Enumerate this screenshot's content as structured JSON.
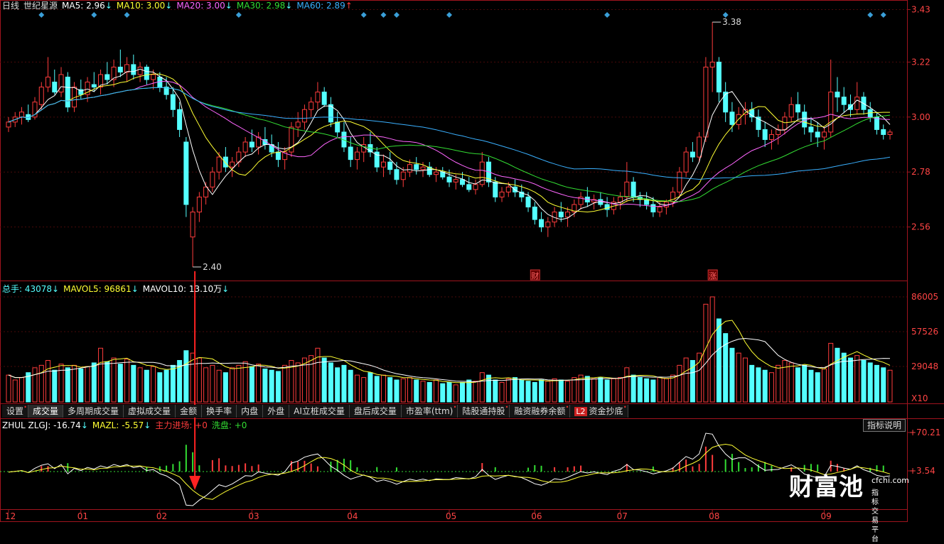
{
  "header": {
    "period": "日线",
    "stock_name": "世纪星源",
    "ma5": "MA5: 2.96",
    "ma10": "MA10: 3.00",
    "ma20": "MA20: 3.00",
    "ma30": "MA30: 2.98",
    "ma60": "MA60: 2.89",
    "arrow_down": "↓",
    "arrow_up": "↑"
  },
  "volume_header": {
    "total": "总手: 43078",
    "mavol5": "MAVOL5: 96861",
    "mavol10": "MAVOL10: 13.10万"
  },
  "indicator_header": {
    "name": "ZHUL ZLGJ: -16.74",
    "mazl": "MAZL: -5.57",
    "main_entry": "主力进场: +0",
    "wash": "洗盘: +0"
  },
  "tabs": [
    {
      "label": "设置",
      "dot": true,
      "active": false,
      "l2": false
    },
    {
      "label": "成交量",
      "dot": false,
      "active": true,
      "l2": false
    },
    {
      "label": "多周期成交量",
      "dot": false,
      "active": false,
      "l2": false
    },
    {
      "label": "虚拟成交量",
      "dot": false,
      "active": false,
      "l2": false
    },
    {
      "label": "金额",
      "dot": false,
      "active": false,
      "l2": false
    },
    {
      "label": "换手率",
      "dot": false,
      "active": false,
      "l2": false
    },
    {
      "label": "内盘",
      "dot": false,
      "active": false,
      "l2": false
    },
    {
      "label": "外盘",
      "dot": false,
      "active": false,
      "l2": false
    },
    {
      "label": "AI立桩成交量",
      "dot": false,
      "active": false,
      "l2": false
    },
    {
      "label": "盘后成交量",
      "dot": false,
      "active": false,
      "l2": false
    },
    {
      "label": "市盈率(ttm)",
      "dot": true,
      "active": false,
      "l2": false
    },
    {
      "label": "陆股通持股",
      "dot": true,
      "active": false,
      "l2": false
    },
    {
      "label": "融资融券余额",
      "dot": true,
      "active": false,
      "l2": false
    },
    {
      "label": "资金抄底",
      "dot": true,
      "active": false,
      "l2": true
    }
  ],
  "l2_badge": "L2",
  "explain_button": "指标说明",
  "brand": {
    "name": "财富池",
    "url": "cfchi.com",
    "slogan": "指标交易平台"
  },
  "colors": {
    "up": "#ff3c3c",
    "down": "#54ffff",
    "ma5": "#ffffff",
    "ma10": "#ffff33",
    "ma20": "#ff66ff",
    "ma30": "#33dd33",
    "ma60": "#3ab0ff",
    "axis": "#a0141e",
    "grid": "#4a0a0a"
  },
  "chart_data": {
    "type": "candlestick",
    "x_tick_labels": [
      "12",
      "01",
      "02",
      "03",
      "04",
      "05",
      "06",
      "07",
      "08",
      "09"
    ],
    "price_axis": {
      "ticks": [
        "3.43",
        "3.22",
        "3.00",
        "2.78",
        "2.56"
      ],
      "ylim": [
        2.36,
        3.44
      ]
    },
    "annotations": {
      "high_label": "3.38",
      "low_label": "2.40",
      "marker_cai": "财",
      "marker_zhang": "涨"
    },
    "candles_ohlc": [
      [
        2.96,
        3.0,
        2.94,
        2.98
      ],
      [
        2.98,
        3.02,
        2.96,
        3.0
      ],
      [
        3.0,
        3.04,
        2.97,
        3.02
      ],
      [
        3.01,
        3.05,
        2.98,
        2.99
      ],
      [
        3.0,
        3.08,
        2.99,
        3.06
      ],
      [
        3.05,
        3.14,
        3.03,
        3.12
      ],
      [
        3.12,
        3.24,
        3.1,
        3.16
      ],
      [
        3.14,
        3.19,
        3.09,
        3.1
      ],
      [
        3.1,
        3.2,
        3.08,
        3.17
      ],
      [
        3.16,
        3.18,
        3.02,
        3.04
      ],
      [
        3.04,
        3.14,
        3.02,
        3.12
      ],
      [
        3.11,
        3.15,
        3.07,
        3.09
      ],
      [
        3.09,
        3.16,
        3.06,
        3.14
      ],
      [
        3.13,
        3.18,
        3.1,
        3.12
      ],
      [
        3.12,
        3.19,
        3.09,
        3.17
      ],
      [
        3.17,
        3.22,
        3.13,
        3.15
      ],
      [
        3.15,
        3.23,
        3.12,
        3.2
      ],
      [
        3.2,
        3.27,
        3.16,
        3.18
      ],
      [
        3.18,
        3.24,
        3.14,
        3.21
      ],
      [
        3.21,
        3.25,
        3.15,
        3.17
      ],
      [
        3.17,
        3.22,
        3.14,
        3.2
      ],
      [
        3.2,
        3.21,
        3.13,
        3.15
      ],
      [
        3.15,
        3.19,
        3.11,
        3.17
      ],
      [
        3.16,
        3.18,
        3.1,
        3.12
      ],
      [
        3.12,
        3.16,
        3.07,
        3.09
      ],
      [
        3.09,
        3.12,
        3.0,
        3.03
      ],
      [
        3.03,
        3.06,
        2.92,
        2.95
      ],
      [
        2.9,
        2.92,
        2.6,
        2.65
      ],
      [
        2.52,
        2.64,
        2.4,
        2.62
      ],
      [
        2.62,
        2.7,
        2.58,
        2.68
      ],
      [
        2.68,
        2.74,
        2.65,
        2.72
      ],
      [
        2.72,
        2.8,
        2.7,
        2.78
      ],
      [
        2.78,
        2.86,
        2.75,
        2.84
      ],
      [
        2.84,
        2.88,
        2.78,
        2.8
      ],
      [
        2.8,
        2.84,
        2.76,
        2.82
      ],
      [
        2.82,
        2.88,
        2.8,
        2.86
      ],
      [
        2.86,
        2.92,
        2.84,
        2.9
      ],
      [
        2.9,
        2.95,
        2.86,
        2.88
      ],
      [
        2.88,
        2.94,
        2.85,
        2.92
      ],
      [
        2.91,
        2.96,
        2.87,
        2.89
      ],
      [
        2.89,
        2.93,
        2.84,
        2.86
      ],
      [
        2.86,
        2.9,
        2.8,
        2.83
      ],
      [
        2.83,
        2.88,
        2.79,
        2.86
      ],
      [
        2.86,
        2.98,
        2.84,
        2.96
      ],
      [
        2.96,
        3.02,
        2.92,
        2.98
      ],
      [
        2.98,
        3.05,
        2.95,
        3.03
      ],
      [
        3.03,
        3.08,
        3.0,
        3.06
      ],
      [
        3.06,
        3.14,
        3.03,
        3.1
      ],
      [
        3.1,
        3.12,
        3.04,
        3.05
      ],
      [
        3.05,
        3.08,
        2.96,
        2.98
      ],
      [
        2.98,
        3.02,
        2.92,
        2.94
      ],
      [
        2.94,
        2.98,
        2.86,
        2.88
      ],
      [
        2.88,
        2.92,
        2.8,
        2.83
      ],
      [
        2.83,
        2.88,
        2.79,
        2.86
      ],
      [
        2.86,
        2.92,
        2.82,
        2.89
      ],
      [
        2.89,
        2.94,
        2.84,
        2.86
      ],
      [
        2.86,
        2.88,
        2.78,
        2.8
      ],
      [
        2.8,
        2.85,
        2.76,
        2.82
      ],
      [
        2.82,
        2.86,
        2.77,
        2.79
      ],
      [
        2.79,
        2.82,
        2.73,
        2.75
      ],
      [
        2.75,
        2.8,
        2.72,
        2.78
      ],
      [
        2.78,
        2.83,
        2.76,
        2.81
      ],
      [
        2.81,
        2.84,
        2.77,
        2.79
      ],
      [
        2.79,
        2.82,
        2.76,
        2.8
      ],
      [
        2.8,
        2.82,
        2.76,
        2.77
      ],
      [
        2.77,
        2.8,
        2.74,
        2.78
      ],
      [
        2.78,
        2.8,
        2.75,
        2.76
      ],
      [
        2.76,
        2.79,
        2.72,
        2.74
      ],
      [
        2.74,
        2.77,
        2.71,
        2.75
      ],
      [
        2.75,
        2.78,
        2.72,
        2.73
      ],
      [
        2.73,
        2.76,
        2.7,
        2.71
      ],
      [
        2.71,
        2.75,
        2.69,
        2.73
      ],
      [
        2.73,
        2.86,
        2.72,
        2.82
      ],
      [
        2.82,
        2.84,
        2.72,
        2.74
      ],
      [
        2.74,
        2.76,
        2.66,
        2.68
      ],
      [
        2.68,
        2.72,
        2.66,
        2.7
      ],
      [
        2.7,
        2.74,
        2.68,
        2.72
      ],
      [
        2.72,
        2.75,
        2.68,
        2.7
      ],
      [
        2.7,
        2.73,
        2.66,
        2.68
      ],
      [
        2.68,
        2.7,
        2.62,
        2.64
      ],
      [
        2.64,
        2.66,
        2.57,
        2.59
      ],
      [
        2.59,
        2.62,
        2.54,
        2.56
      ],
      [
        2.56,
        2.6,
        2.52,
        2.58
      ],
      [
        2.58,
        2.64,
        2.56,
        2.62
      ],
      [
        2.62,
        2.66,
        2.58,
        2.6
      ],
      [
        2.6,
        2.64,
        2.56,
        2.62
      ],
      [
        2.62,
        2.67,
        2.6,
        2.65
      ],
      [
        2.65,
        2.7,
        2.63,
        2.68
      ],
      [
        2.68,
        2.72,
        2.64,
        2.66
      ],
      [
        2.66,
        2.69,
        2.63,
        2.67
      ],
      [
        2.67,
        2.7,
        2.64,
        2.65
      ],
      [
        2.65,
        2.68,
        2.6,
        2.63
      ],
      [
        2.63,
        2.68,
        2.61,
        2.66
      ],
      [
        2.66,
        2.7,
        2.63,
        2.68
      ],
      [
        2.68,
        2.82,
        2.66,
        2.74
      ],
      [
        2.74,
        2.76,
        2.66,
        2.68
      ],
      [
        2.68,
        2.7,
        2.64,
        2.67
      ],
      [
        2.67,
        2.7,
        2.63,
        2.65
      ],
      [
        2.65,
        2.68,
        2.6,
        2.62
      ],
      [
        2.62,
        2.66,
        2.6,
        2.64
      ],
      [
        2.64,
        2.67,
        2.61,
        2.66
      ],
      [
        2.66,
        2.72,
        2.64,
        2.7
      ],
      [
        2.7,
        2.8,
        2.68,
        2.78
      ],
      [
        2.78,
        2.88,
        2.76,
        2.86
      ],
      [
        2.86,
        2.9,
        2.82,
        2.84
      ],
      [
        2.84,
        2.94,
        2.82,
        2.92
      ],
      [
        2.92,
        3.24,
        2.9,
        3.2
      ],
      [
        3.2,
        3.38,
        3.1,
        3.22
      ],
      [
        3.22,
        3.24,
        3.06,
        3.1
      ],
      [
        3.1,
        3.14,
        2.98,
        3.02
      ],
      [
        3.02,
        3.06,
        2.94,
        2.97
      ],
      [
        2.97,
        3.04,
        2.95,
        3.01
      ],
      [
        3.01,
        3.06,
        2.97,
        3.03
      ],
      [
        3.03,
        3.06,
        2.98,
        3.0
      ],
      [
        3.0,
        3.03,
        2.92,
        2.95
      ],
      [
        2.95,
        2.98,
        2.88,
        2.91
      ],
      [
        2.91,
        2.95,
        2.87,
        2.93
      ],
      [
        2.93,
        2.97,
        2.89,
        2.95
      ],
      [
        2.95,
        3.02,
        2.93,
        3.0
      ],
      [
        3.0,
        3.08,
        2.98,
        3.05
      ],
      [
        3.05,
        3.1,
        2.99,
        3.02
      ],
      [
        3.02,
        3.05,
        2.93,
        2.96
      ],
      [
        2.96,
        3.0,
        2.9,
        2.94
      ],
      [
        2.94,
        2.98,
        2.88,
        2.92
      ],
      [
        2.92,
        2.96,
        2.87,
        2.94
      ],
      [
        2.94,
        3.23,
        2.92,
        3.1
      ],
      [
        3.1,
        3.16,
        3.02,
        3.08
      ],
      [
        3.08,
        3.12,
        3.02,
        3.05
      ],
      [
        3.05,
        3.09,
        3.0,
        3.03
      ],
      [
        3.03,
        3.14,
        3.01,
        3.08
      ],
      [
        3.08,
        3.1,
        3.01,
        3.03
      ],
      [
        3.03,
        3.06,
        2.98,
        3.0
      ],
      [
        3.0,
        3.02,
        2.93,
        2.95
      ],
      [
        2.95,
        2.97,
        2.91,
        2.93
      ],
      [
        2.93,
        2.95,
        2.91,
        2.94
      ]
    ],
    "ma_series": [
      {
        "name": "MA5",
        "period": 5
      },
      {
        "name": "MA10",
        "period": 10
      },
      {
        "name": "MA20",
        "period": 20
      },
      {
        "name": "MA30",
        "period": 30
      },
      {
        "name": "MA60",
        "period": 60
      }
    ],
    "volume_axis": {
      "ticks": [
        "86005",
        "57526",
        "29048"
      ],
      "unit": "X10"
    },
    "volume": [
      22000,
      18000,
      20000,
      24000,
      28000,
      30000,
      34000,
      26000,
      31000,
      28000,
      30000,
      27000,
      29000,
      32000,
      44000,
      33000,
      36000,
      31000,
      35000,
      30000,
      28000,
      26000,
      29000,
      24000,
      26000,
      30000,
      34000,
      42000,
      40000,
      36000,
      28000,
      30000,
      26000,
      24000,
      28000,
      30000,
      33000,
      29000,
      31000,
      27000,
      26000,
      25000,
      30000,
      34000,
      32000,
      36000,
      38000,
      44000,
      36000,
      32000,
      28000,
      30000,
      26000,
      22000,
      20000,
      24000,
      21000,
      22000,
      20000,
      18000,
      19000,
      20000,
      18000,
      17000,
      16000,
      18000,
      15000,
      16000,
      14000,
      16000,
      18000,
      17000,
      24000,
      22000,
      18000,
      16000,
      19000,
      20000,
      18000,
      17000,
      16000,
      18000,
      17000,
      19000,
      18000,
      17000,
      20000,
      22000,
      21000,
      19000,
      20000,
      18000,
      19000,
      20000,
      28000,
      22000,
      20000,
      19000,
      18000,
      20000,
      19000,
      22000,
      30000,
      36000,
      34000,
      40000,
      80000,
      86000,
      68000,
      56000,
      44000,
      40000,
      36000,
      30000,
      28000,
      26000,
      24000,
      30000,
      34000,
      32000,
      28000,
      30000,
      26000,
      24000,
      27000,
      48000,
      44000,
      40000,
      36000,
      38000,
      34000,
      32000,
      30000,
      28000,
      26000
    ],
    "indicator_axis": {
      "ticks": [
        "+70.21",
        "+3.54"
      ]
    }
  }
}
